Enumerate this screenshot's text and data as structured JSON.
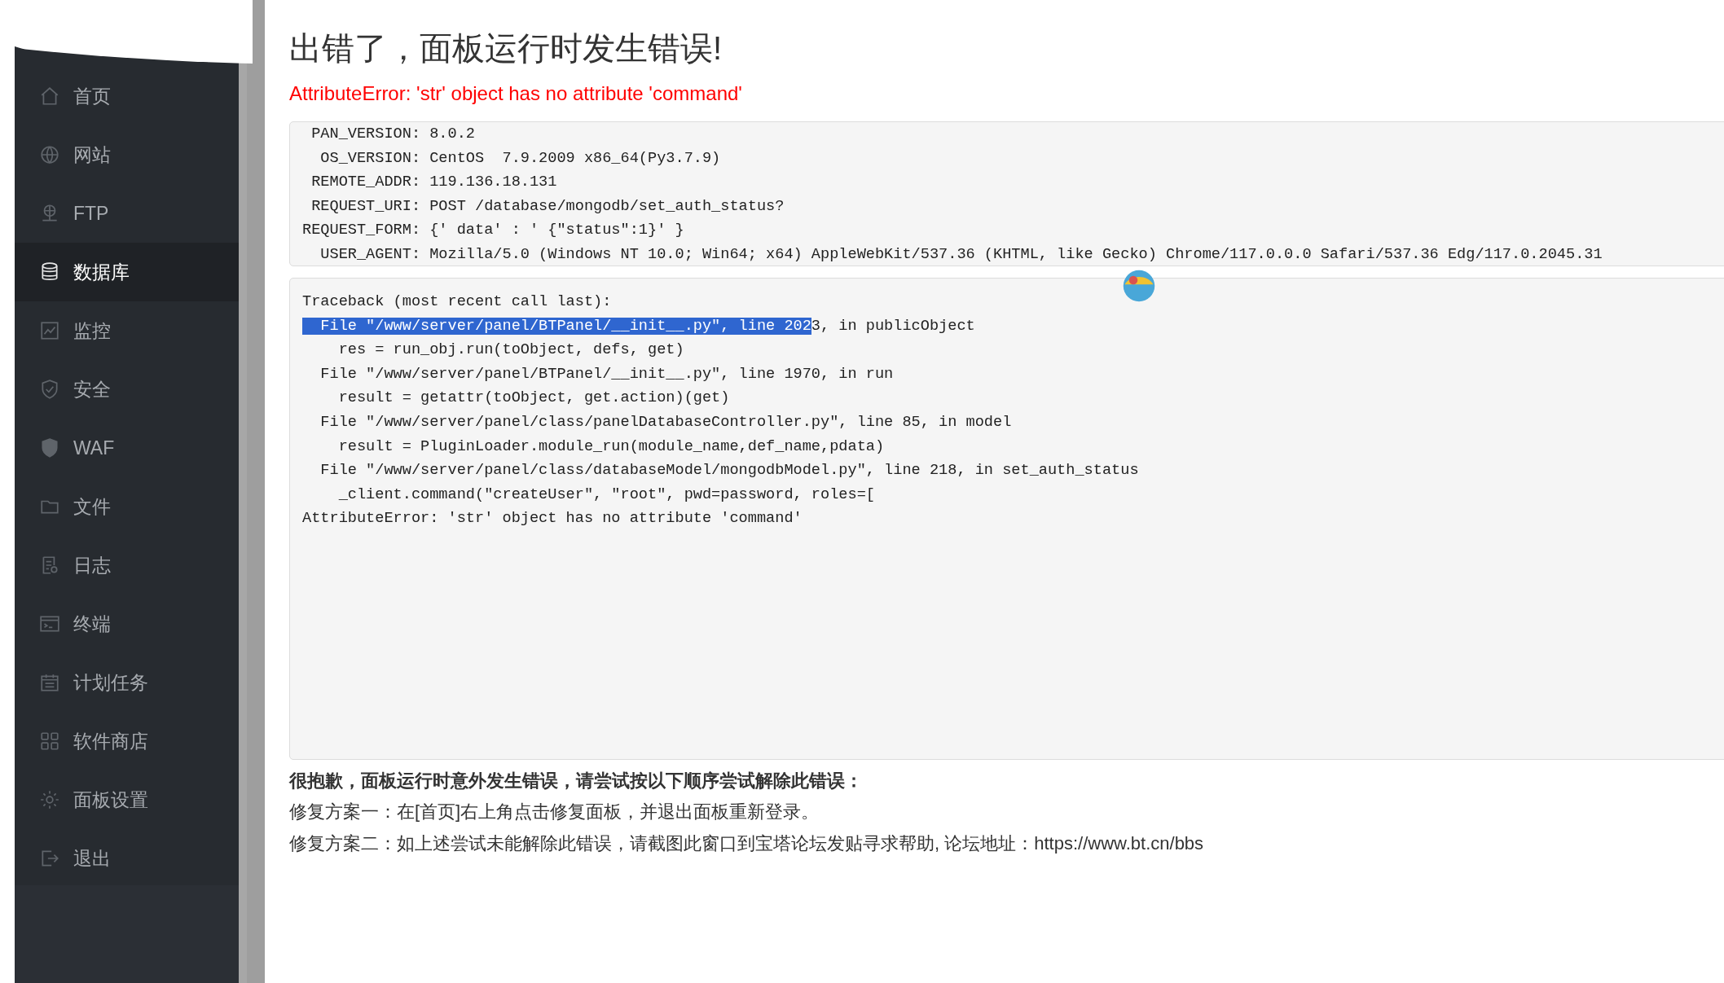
{
  "sidebar": {
    "items": [
      {
        "label": "首页",
        "selected": false
      },
      {
        "label": "网站",
        "selected": false
      },
      {
        "label": "FTP",
        "selected": false
      },
      {
        "label": "数据库",
        "selected": true
      },
      {
        "label": "监控",
        "selected": false
      },
      {
        "label": "安全",
        "selected": false
      },
      {
        "label": "WAF",
        "selected": false
      },
      {
        "label": "文件",
        "selected": false
      },
      {
        "label": "日志",
        "selected": false
      },
      {
        "label": "终端",
        "selected": false
      },
      {
        "label": "计划任务",
        "selected": false
      },
      {
        "label": "软件商店",
        "selected": false
      },
      {
        "label": "面板设置",
        "selected": false
      },
      {
        "label": "退出",
        "selected": false
      }
    ]
  },
  "title": "出错了，面板运行时发生错误!",
  "error_message": "AttributeError: 'str' object has no attribute 'command'",
  "info_lines": [
    " PAN_VERSION: 8.0.2",
    "  OS_VERSION: CentOS  7.9.2009 x86_64(Py3.7.9)",
    " REMOTE_ADDR: 119.136.18.131",
    " REQUEST_URI: POST /database/mongodb/set_auth_status?",
    "REQUEST_FORM: {′ data′ : ′ {\"status\":1}′ }",
    "  USER_AGENT: Mozilla/5.0 (Windows NT 10.0; Win64; x64) AppleWebKit/537.36 (KHTML, like Gecko) Chrome/117.0.0.0 Safari/537.36 Edg/117.0.2045.31"
  ],
  "traceback_lines": [
    [
      {
        "text": "Traceback (most recent call last):",
        "selected": false
      }
    ],
    [
      {
        "text": "  File \"/www/server/panel/BTPanel/__init__.py\", line 202",
        "selected": true
      },
      {
        "text": "3, in publicObject",
        "selected": false
      }
    ],
    [
      {
        "text": "    res = run_obj.run(toObject, defs, get)",
        "selected": false
      }
    ],
    [
      {
        "text": "  File \"/www/server/panel/BTPanel/__init__.py\", line 1970, in run",
        "selected": false
      }
    ],
    [
      {
        "text": "    result = getattr(toObject, get.action)(get)",
        "selected": false
      }
    ],
    [
      {
        "text": "  File \"/www/server/panel/class/panelDatabaseController.py\", line 85, in model",
        "selected": false
      }
    ],
    [
      {
        "text": "    result = PluginLoader.module_run(module_name,def_name,pdata)",
        "selected": false
      }
    ],
    [
      {
        "text": "  File \"/www/server/panel/class/databaseModel/mongodbModel.py\", line 218, in set_auth_status",
        "selected": false
      }
    ],
    [
      {
        "text": "    _client.command(\"createUser\", \"root\", pwd=password, roles=[",
        "selected": false
      }
    ],
    [
      {
        "text": "AttributeError: 'str' object has no attribute 'command'",
        "selected": false
      }
    ]
  ],
  "help": {
    "heading": "很抱歉，面板运行时意外发生错误，请尝试按以下顺序尝试解除此错误：",
    "lines": [
      "修复方案一：在[首页]右上角点击修复面板，并退出面板重新登录。",
      "修复方案二：如上述尝试未能解除此错误，请截图此窗口到宝塔论坛发贴寻求帮助, 论坛地址：https://www.bt.cn/bbs"
    ]
  }
}
